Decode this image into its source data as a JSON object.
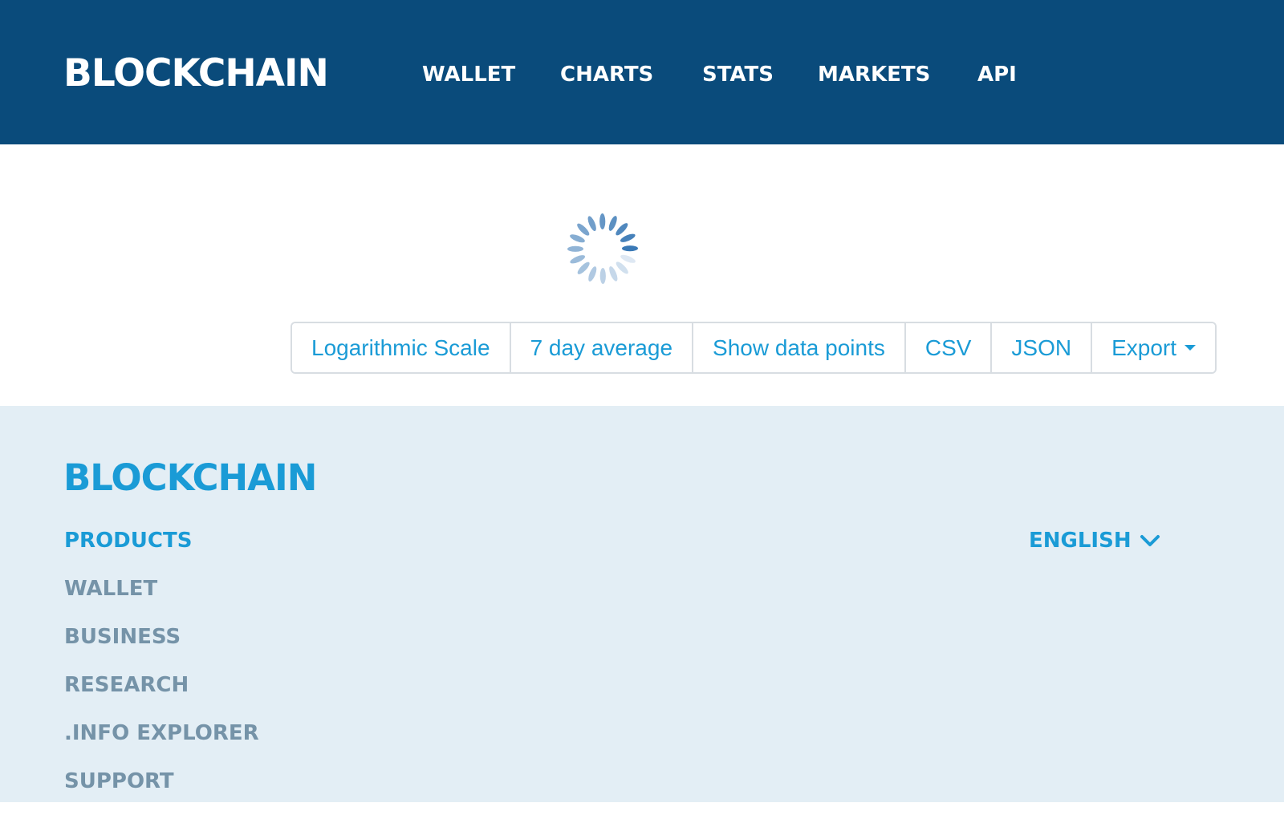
{
  "header": {
    "brand": "BLOCKCHAIN",
    "nav": [
      {
        "label": "WALLET"
      },
      {
        "label": "CHARTS"
      },
      {
        "label": "STATS"
      },
      {
        "label": "MARKETS"
      },
      {
        "label": "API"
      }
    ]
  },
  "loader": {
    "icon": "loading-spinner-icon",
    "color": "#3a79b6"
  },
  "chart_options": {
    "log_scale": "Logarithmic Scale",
    "seven_day_average": "7 day average",
    "show_data_points": "Show data points",
    "csv": "CSV",
    "json": "JSON",
    "export": "Export",
    "export_icon": "caret-down-icon"
  },
  "footer": {
    "brand": "BLOCKCHAIN",
    "products_heading": "PRODUCTS",
    "links": [
      {
        "label": "WALLET"
      },
      {
        "label": "BUSINESS"
      },
      {
        "label": "RESEARCH"
      },
      {
        "label": ".INFO EXPLORER"
      },
      {
        "label": "SUPPORT"
      }
    ],
    "language": "ENGLISH",
    "language_icon": "chevron-down-icon"
  },
  "colors": {
    "header_bg": "#0a4b7b",
    "accent": "#1a9bd6",
    "footer_bg": "#e3eef5",
    "footer_link": "#7593a8"
  }
}
